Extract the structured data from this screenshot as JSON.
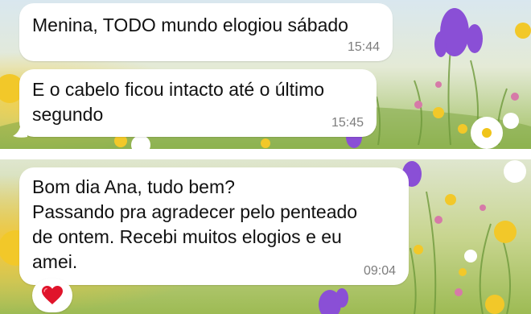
{
  "chat": {
    "messages": [
      {
        "text": "Menina, TODO mundo elogiou sábado",
        "time": "15:44"
      },
      {
        "text": "E o cabelo ficou intacto até o último\nsegundo",
        "time": "15:45"
      },
      {
        "text": "Bom dia Ana, tudo bem?\nPassando pra agradecer pelo penteado\nde ontem. Recebi muitos elogios e eu\namei.",
        "time": "09:04"
      }
    ],
    "reaction": {
      "icon": "red-heart-icon",
      "emoji": "❤️"
    }
  },
  "colors": {
    "bubble": "#ffffff",
    "text": "#111111",
    "timestamp": "#7d7d7d",
    "heart": "#e0142b"
  },
  "wallpaper": {
    "description_icon": "wildflower-meadow-wallpaper"
  }
}
